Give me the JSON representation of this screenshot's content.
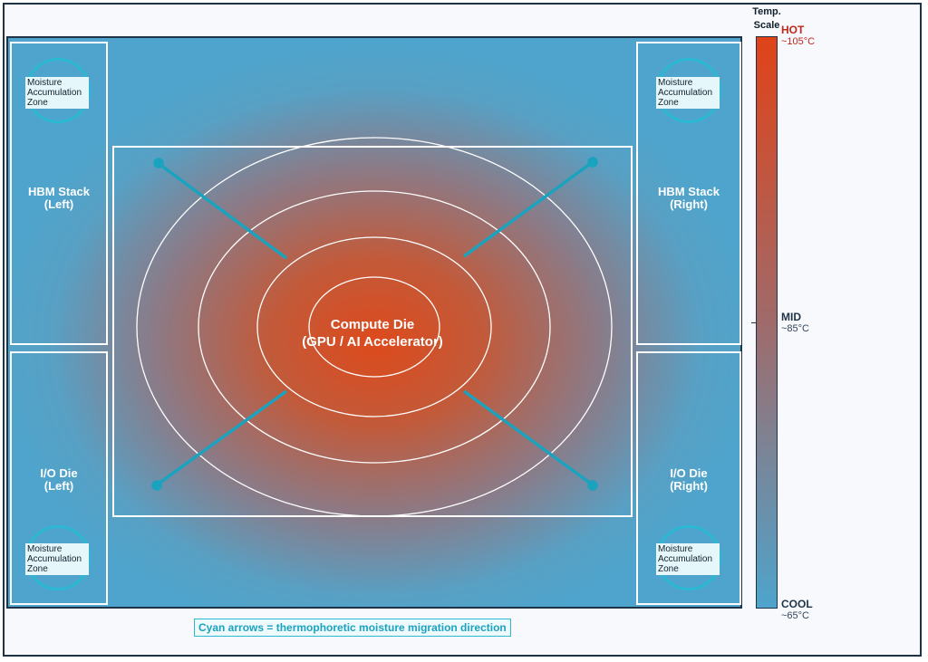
{
  "package": {
    "compute_die": {
      "label": "Compute Die\n(GPU / AI Accelerator)"
    },
    "hbm_left": {
      "label": "HBM Stack\n(Left)"
    },
    "hbm_right": {
      "label": "HBM Stack\n(Right)"
    },
    "io_left": {
      "label": "I/O Die\n(Left)"
    },
    "io_right": {
      "label": "I/O Die\n(Right)"
    },
    "moisture_zone_label": "Moisture\nAccumulation\nZone"
  },
  "temperature_scale": {
    "title": "Temp.\nScale",
    "hot": {
      "name": "HOT",
      "temp": "~105°C",
      "color": "#c0281a"
    },
    "mid": {
      "name": "MID",
      "temp": "~85°C",
      "color": "#1f3347"
    },
    "cool": {
      "name": "COOL",
      "temp": "~65°C",
      "color": "#1f3347"
    }
  },
  "legend_note": "Cyan arrows = thermophoretic moisture migration direction",
  "colors": {
    "hot": "#dd4a1c",
    "cool": "#4ea4cc",
    "arrow": "#1aa3bf",
    "outline": "#1f3347"
  }
}
